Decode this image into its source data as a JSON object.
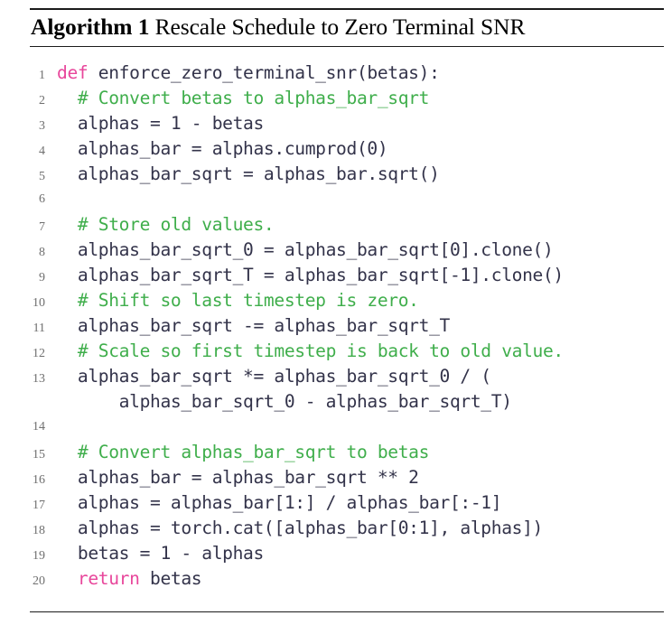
{
  "algorithm": {
    "label": "Algorithm 1",
    "title": "Rescale Schedule to Zero Terminal SNR",
    "keyword_color": "#e8469b",
    "comment_color": "#3fae4b",
    "code_color": "#33334a",
    "lineno_color": "#6f6f6f",
    "rule_color": "#1b1b1b",
    "language": "python",
    "lines": [
      {
        "n": "1",
        "tokens": [
          {
            "t": "kw",
            "s": "def"
          },
          {
            "t": "pl",
            "s": " enforce_zero_terminal_snr(betas):"
          }
        ]
      },
      {
        "n": "2",
        "tokens": [
          {
            "t": "cm",
            "s": "  # Convert betas to alphas_bar_sqrt"
          }
        ]
      },
      {
        "n": "3",
        "tokens": [
          {
            "t": "pl",
            "s": "  alphas = 1 - betas"
          }
        ]
      },
      {
        "n": "4",
        "tokens": [
          {
            "t": "pl",
            "s": "  alphas_bar = alphas.cumprod(0)"
          }
        ]
      },
      {
        "n": "5",
        "tokens": [
          {
            "t": "pl",
            "s": "  alphas_bar_sqrt = alphas_bar.sqrt()"
          }
        ]
      },
      {
        "n": "6",
        "tokens": [
          {
            "t": "pl",
            "s": ""
          }
        ]
      },
      {
        "n": "7",
        "tokens": [
          {
            "t": "cm",
            "s": "  # Store old values."
          }
        ]
      },
      {
        "n": "8",
        "tokens": [
          {
            "t": "pl",
            "s": "  alphas_bar_sqrt_0 = alphas_bar_sqrt[0].clone()"
          }
        ]
      },
      {
        "n": "9",
        "tokens": [
          {
            "t": "pl",
            "s": "  alphas_bar_sqrt_T = alphas_bar_sqrt[-1].clone()"
          }
        ]
      },
      {
        "n": "10",
        "tokens": [
          {
            "t": "cm",
            "s": "  # Shift so last timestep is zero."
          }
        ]
      },
      {
        "n": "11",
        "tokens": [
          {
            "t": "pl",
            "s": "  alphas_bar_sqrt -= alphas_bar_sqrt_T"
          }
        ]
      },
      {
        "n": "12",
        "tokens": [
          {
            "t": "cm",
            "s": "  # Scale so first timestep is back to old value."
          }
        ]
      },
      {
        "n": "13",
        "tokens": [
          {
            "t": "pl",
            "s": "  alphas_bar_sqrt *= alphas_bar_sqrt_0 / ("
          }
        ]
      },
      {
        "n": "",
        "tokens": [
          {
            "t": "pl",
            "s": "      alphas_bar_sqrt_0 - alphas_bar_sqrt_T)"
          }
        ]
      },
      {
        "n": "14",
        "tokens": [
          {
            "t": "pl",
            "s": ""
          }
        ]
      },
      {
        "n": "15",
        "tokens": [
          {
            "t": "cm",
            "s": "  # Convert alphas_bar_sqrt to betas"
          }
        ]
      },
      {
        "n": "16",
        "tokens": [
          {
            "t": "pl",
            "s": "  alphas_bar = alphas_bar_sqrt ** 2"
          }
        ]
      },
      {
        "n": "17",
        "tokens": [
          {
            "t": "pl",
            "s": "  alphas = alphas_bar[1:] / alphas_bar[:-1]"
          }
        ]
      },
      {
        "n": "18",
        "tokens": [
          {
            "t": "pl",
            "s": "  alphas = torch.cat([alphas_bar[0:1], alphas])"
          }
        ]
      },
      {
        "n": "19",
        "tokens": [
          {
            "t": "pl",
            "s": "  betas = 1 - alphas"
          }
        ]
      },
      {
        "n": "20",
        "tokens": [
          {
            "t": "kw",
            "s": "  return"
          },
          {
            "t": "pl",
            "s": " betas"
          }
        ]
      }
    ]
  }
}
